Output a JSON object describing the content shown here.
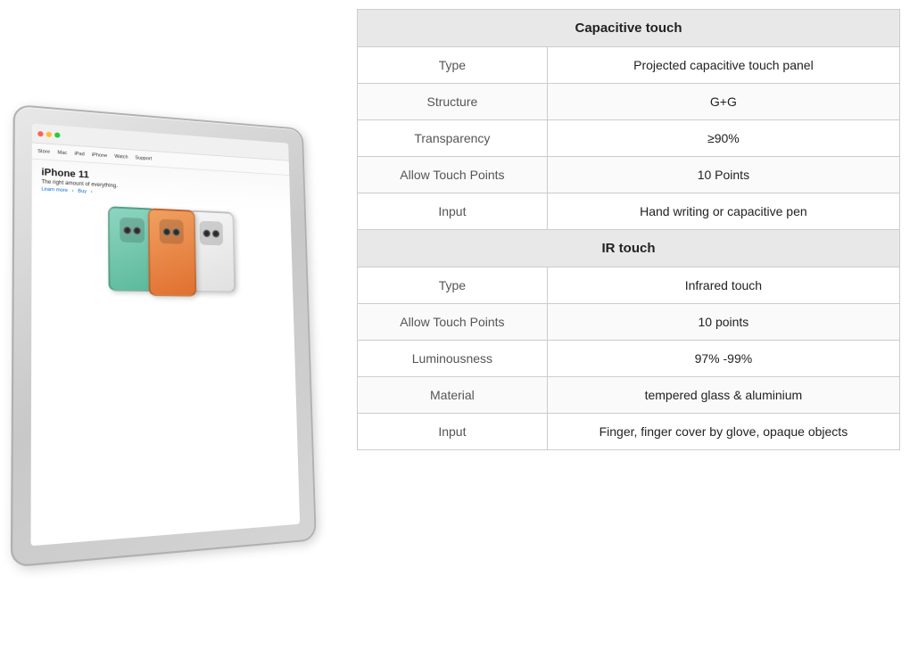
{
  "left": {
    "alt": "Monitor showing iPhone 11 Apple webpage"
  },
  "table": {
    "capacitive_header": "Capacitive touch",
    "ir_header": "IR touch",
    "rows_capacitive": [
      {
        "label": "Type",
        "value": "Projected capacitive touch panel"
      },
      {
        "label": "Structure",
        "value": "G+G"
      },
      {
        "label": "Transparency",
        "value": "≥90%"
      },
      {
        "label": "Allow Touch Points",
        "value": "10 Points"
      },
      {
        "label": "Input",
        "value": "Hand writing or capacitive pen"
      }
    ],
    "rows_ir": [
      {
        "label": "Type",
        "value": "Infrared touch"
      },
      {
        "label": "Allow Touch Points",
        "value": "10 points"
      },
      {
        "label": "Luminousness",
        "value": "97% -99%"
      },
      {
        "label": "Material",
        "value": "tempered glass & aluminium"
      },
      {
        "label": "Input",
        "value": "Finger, finger cover by glove, opaque objects"
      }
    ]
  },
  "browser": {
    "title": "iPhone 11",
    "subtitle": "The right amount of everything.",
    "link1": "Learn more",
    "link2": "Buy"
  }
}
